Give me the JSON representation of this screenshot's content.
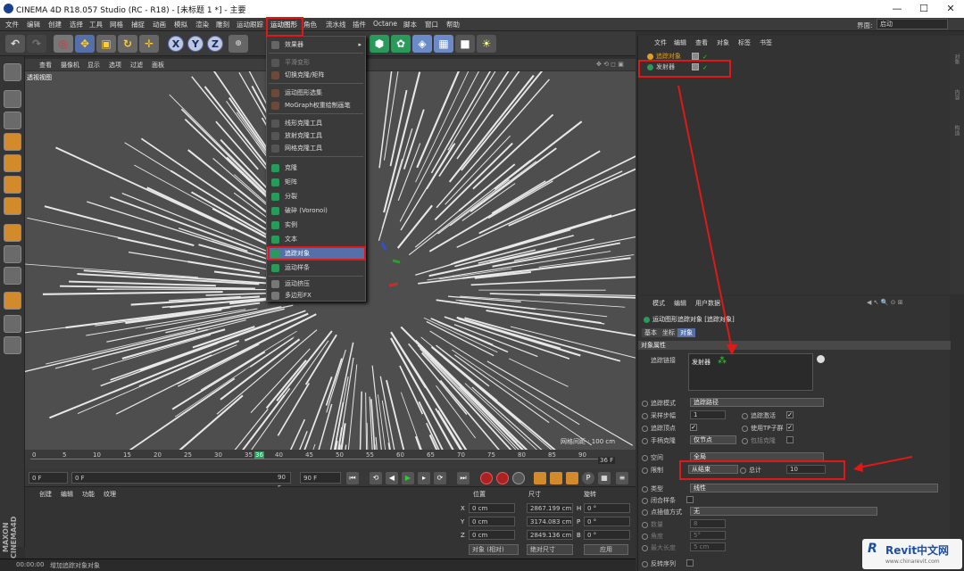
{
  "window": {
    "title": "CINEMA 4D R18.057 Studio (RC - R18) - [未标题 1 *] - 主要",
    "min": "—",
    "max": "☐",
    "close": "✕"
  },
  "menubar": {
    "items": [
      "文件",
      "编辑",
      "创建",
      "选择",
      "工具",
      "网格",
      "捕捉",
      "动画",
      "模拟",
      "渲染",
      "雕刻",
      "运动跟踪",
      "运动图形",
      "角色",
      "流水线",
      "插件",
      "Octane",
      "脚本",
      "窗口",
      "帮助"
    ],
    "layout_label": "界面:",
    "layout_value": "启动"
  },
  "viewport": {
    "menu": [
      "查看",
      "摄像机",
      "显示",
      "选项",
      "过滤",
      "面板"
    ],
    "label": "透视视图",
    "grid": "网格间距 : 100 cm"
  },
  "timeline": {
    "ticks": [
      "0",
      "5",
      "10",
      "15",
      "20",
      "25",
      "30",
      "35",
      "36",
      "40",
      "45",
      "50",
      "55",
      "60",
      "65",
      "70",
      "75",
      "80",
      "85",
      "90"
    ],
    "end": "36 F"
  },
  "playbar": {
    "start": "0 F",
    "cur": "0 F",
    "end1": "90 F",
    "end2": "90 F"
  },
  "material": {
    "menu": [
      "创建",
      "编辑",
      "功能",
      "纹理"
    ]
  },
  "coords": {
    "headers": [
      "位置",
      "尺寸",
      "旋转"
    ],
    "rows": [
      {
        "a": "X",
        "p": "0 cm",
        "s": "2867.199 cm",
        "r": "H",
        "rv": "0 °"
      },
      {
        "a": "Y",
        "p": "0 cm",
        "s": "3174.083 cm",
        "r": "P",
        "rv": "0 °"
      },
      {
        "a": "Z",
        "p": "0 cm",
        "s": "2849.136 cm",
        "r": "B",
        "rv": "0 °"
      }
    ],
    "mode": "对象 (相对)",
    "size_mode": "绝对尺寸",
    "apply": "应用"
  },
  "status": {
    "time": "00:00:00",
    "msg": "增加追踪对象对象"
  },
  "objects": {
    "menu": [
      "文件",
      "编辑",
      "查看",
      "对象",
      "标签",
      "书签"
    ],
    "items": [
      {
        "name": "追踪对象",
        "color": "#e0a020"
      },
      {
        "name": "发射器",
        "color": "#2a9a5a"
      }
    ]
  },
  "attributes": {
    "menu": [
      "模式",
      "编辑",
      "用户数据"
    ],
    "title": "运动图形追踪对象 [追踪对象]",
    "tabs": [
      "基本",
      "坐标",
      "对象"
    ],
    "section": "对象属性",
    "trace_link_label": "追踪链接",
    "trace_link_value": "发射器",
    "trace_mode_label": "追踪模式",
    "trace_mode_value": "追踪路径",
    "sample_label": "采样步幅",
    "sample_value": "1",
    "trace_active_label": "追踪激活",
    "trace_vertex_label": "追踪顶点",
    "use_tp_label": "使用TP子群",
    "hand_clone_label": "手柄克隆",
    "hand_clone_value": "仅节点",
    "link_clone_label": "包括克隆",
    "space_label": "空间",
    "space_value": "全局",
    "limit_label": "限制",
    "limit_value": "从结束",
    "total_label": "总计",
    "total_value": "10",
    "type_label": "类型",
    "type_value": "线性",
    "close_spline_label": "闭合样条",
    "interp_label": "点插值方式",
    "interp_value": "无",
    "count_label": "数量",
    "count_value": "8",
    "angle_label": "角度",
    "angle_value": "5°",
    "maxlen_label": "最大长度",
    "maxlen_value": "5 cm",
    "reverse_label": "反转序列"
  },
  "dropdown": {
    "header": "效果器",
    "items": [
      {
        "label": "克隆",
        "dim": false
      },
      {
        "label": "矩阵",
        "dim": false
      },
      {
        "label": "分裂",
        "dim": false
      },
      {
        "label": "破碎 (Voronoi)",
        "dim": false
      },
      {
        "label": "实例",
        "dim": false
      },
      {
        "label": "文本",
        "dim": false
      },
      {
        "label": "追踪对象",
        "dim": false
      },
      {
        "label": "运动样条",
        "dim": false
      },
      {
        "label": "运动挤压",
        "dim": false
      },
      {
        "label": "多边形FX",
        "dim": false
      }
    ],
    "top_items": [
      {
        "label": "平滑变形",
        "dim": true
      },
      {
        "label": "切换克隆/矩阵",
        "dim": false
      },
      {
        "label": "运动图形选集",
        "dim": false
      },
      {
        "label": "MoGraph权重绘制画笔",
        "dim": false
      },
      {
        "label": "线形克隆工具",
        "dim": false
      },
      {
        "label": "放射克隆工具",
        "dim": false
      },
      {
        "label": "网格克隆工具",
        "dim": false
      }
    ]
  },
  "watermark": {
    "brand": "Revit中文网",
    "url": "www.chinarevit.com",
    "r": "R"
  }
}
